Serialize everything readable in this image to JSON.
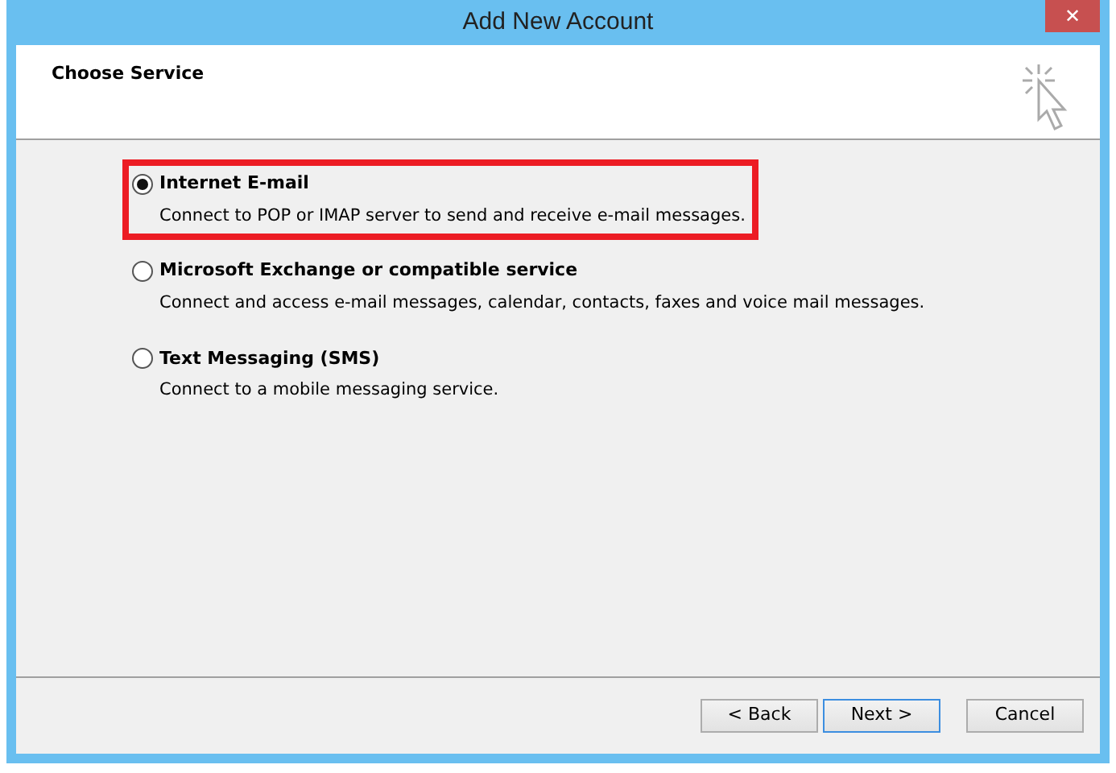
{
  "window": {
    "title": "Add New Account",
    "close": "✕"
  },
  "header": {
    "title": "Choose Service"
  },
  "options": [
    {
      "label": "Internet E-mail",
      "description": "Connect to POP or IMAP server to send and receive e-mail messages.",
      "selected": true,
      "highlighted": true
    },
    {
      "label": "Microsoft Exchange or compatible service",
      "description": "Connect and access e-mail messages, calendar, contacts, faxes and voice mail messages.",
      "selected": false,
      "highlighted": false
    },
    {
      "label": "Text Messaging (SMS)",
      "description": "Connect to a mobile messaging service.",
      "selected": false,
      "highlighted": false
    }
  ],
  "buttons": [
    {
      "label": "< Back",
      "default": false
    },
    {
      "label": "Next >",
      "default": true
    },
    {
      "label": "Cancel",
      "default": false
    }
  ]
}
